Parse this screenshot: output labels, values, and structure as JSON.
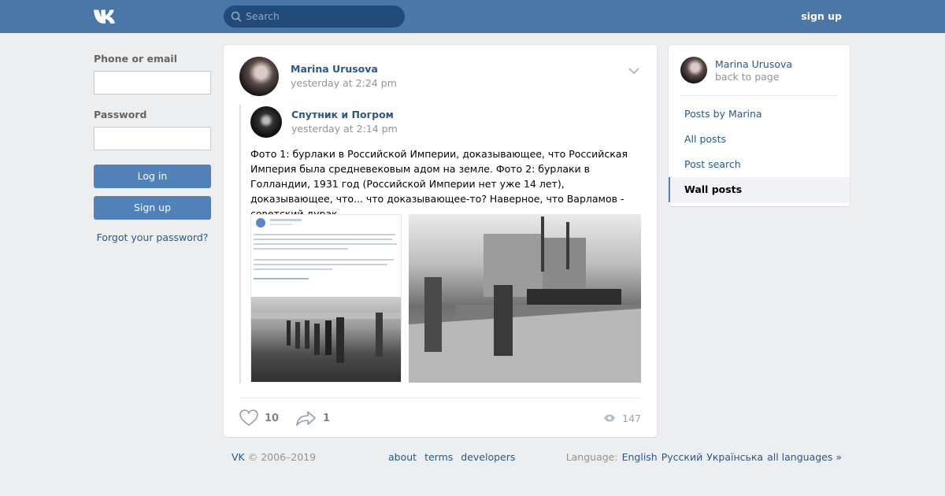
{
  "header": {
    "search_placeholder": "Search",
    "signup_link": "sign up",
    "colors": {
      "bar": "#4a76a8",
      "search_bg": "#224b7a"
    }
  },
  "login": {
    "phone_label": "Phone or email",
    "password_label": "Password",
    "login_button": "Log in",
    "signup_button": "Sign up",
    "forgot_link": "Forgot your password?"
  },
  "post": {
    "author": "Marina Urusova",
    "date": "yesterday at 2:24 pm",
    "repost": {
      "author": "Спутник и Погром",
      "date": "yesterday at 2:14 pm",
      "device_icon": "apple-icon",
      "text": "Фото 1: бурлаки в Российской Империи, доказывающее, что Российская Империя была средневековым адом на земле. Фото 2: бурлаки в Голландии, 1931 год (Российской Империи нет уже 14 лет), доказывающее, что... что доказывающее-то? Наверное, что Варламов - советский дурак."
    },
    "likes": "10",
    "shares": "1",
    "views": "147"
  },
  "sidebar": {
    "name": "Marina Urusova",
    "back": "back to page",
    "items": [
      {
        "label": "Posts by Marina",
        "active": false
      },
      {
        "label": "All posts",
        "active": false
      },
      {
        "label": "Post search",
        "active": false
      },
      {
        "label": "Wall posts",
        "active": true
      }
    ]
  },
  "footer": {
    "copyright_brand": "VK",
    "copyright_years": "© 2006–2019",
    "links": [
      "about",
      "terms",
      "developers"
    ],
    "language_label": "Language:",
    "languages": [
      "English",
      "Русский",
      "Українська",
      "all languages »"
    ]
  }
}
